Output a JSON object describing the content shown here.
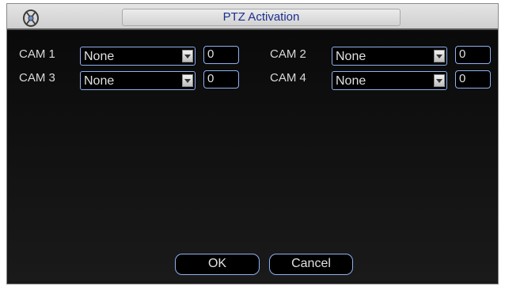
{
  "window": {
    "title": "PTZ Activation",
    "logo_icon": "dvr-logo-icon"
  },
  "cameras": [
    {
      "label": "CAM 1",
      "selection": "None",
      "value": "0"
    },
    {
      "label": "CAM 2",
      "selection": "None",
      "value": "0"
    },
    {
      "label": "CAM 3",
      "selection": "None",
      "value": "0"
    },
    {
      "label": "CAM 4",
      "selection": "None",
      "value": "0"
    }
  ],
  "buttons": {
    "ok_label": "OK",
    "cancel_label": "Cancel"
  },
  "colors": {
    "title_text": "#1a2f8e",
    "field_border": "#8fb1f0",
    "background": "#000000"
  }
}
